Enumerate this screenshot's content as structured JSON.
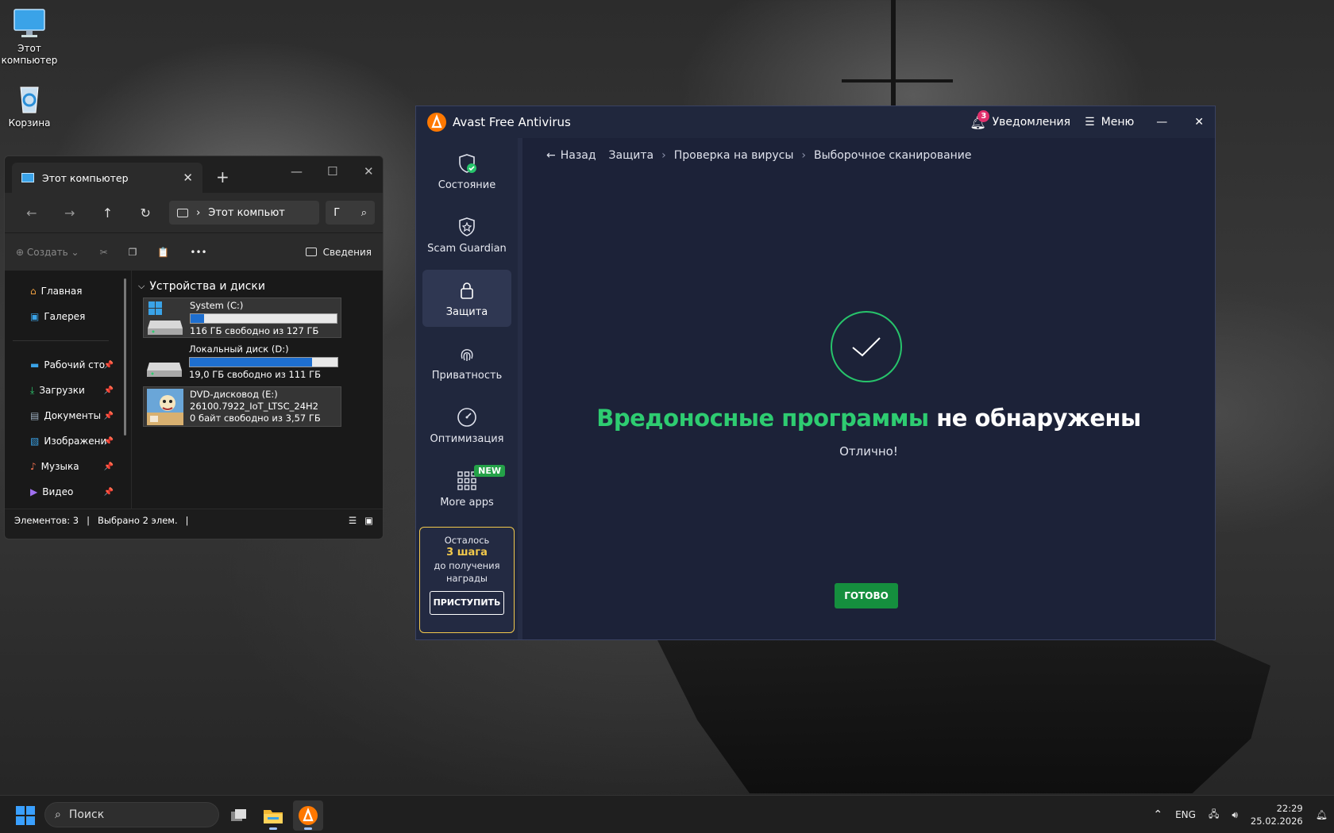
{
  "desktop": {
    "icons": [
      {
        "label": "Этот компьютер"
      },
      {
        "label": "Корзина"
      }
    ]
  },
  "explorer": {
    "tab_title": "Этот компьютер",
    "address": "Этот компьют",
    "search_text": "Г",
    "toolbar": {
      "create_label": "Создать",
      "details_label": "Сведения"
    },
    "sidebar": {
      "items": [
        {
          "label": "Главная",
          "pinned": false
        },
        {
          "label": "Галерея",
          "pinned": false
        },
        {
          "label": "Рабочий сто",
          "pinned": true
        },
        {
          "label": "Загрузки",
          "pinned": true
        },
        {
          "label": "Документы",
          "pinned": true
        },
        {
          "label": "Изображени",
          "pinned": true
        },
        {
          "label": "Музыка",
          "pinned": true
        },
        {
          "label": "Видео",
          "pinned": true
        }
      ]
    },
    "group_title": "Устройства и диски",
    "drives": [
      {
        "name": "System (C:)",
        "info": "116 ГБ свободно из 127 ГБ",
        "used_fraction": 0.09
      },
      {
        "name": "Локальный диск (D:)",
        "info": "19,0 ГБ свободно из 111 ГБ",
        "used_fraction": 0.83
      },
      {
        "name": "DVD-дисковод (E:)",
        "label2": "26100.7922_IoT_LTSC_24H2",
        "info": "0 байт свободно из 3,57 ГБ"
      }
    ],
    "status": {
      "items": "Элементов: 3",
      "selected": "Выбрано 2 элем."
    }
  },
  "avast": {
    "title": "Avast Free Antivirus",
    "notifications_label": "Уведомления",
    "notifications_count": "3",
    "menu_label": "Меню",
    "nav": [
      {
        "label": "Состояние",
        "icon": "shield-check-icon"
      },
      {
        "label": "Scam Guardian",
        "icon": "shield-star-icon"
      },
      {
        "label": "Защита",
        "icon": "lock-icon",
        "active": true
      },
      {
        "label": "Приватность",
        "icon": "fingerprint-icon"
      },
      {
        "label": "Оптимизация",
        "icon": "gauge-icon"
      },
      {
        "label": "More apps",
        "icon": "grid-icon",
        "badge": "NEW"
      }
    ],
    "reward": {
      "line1": "Осталось",
      "steps": "3 шага",
      "line2": "до получения",
      "line3": "награды",
      "button": "ПРИСТУПИТЬ"
    },
    "breadcrumb": {
      "back": "Назад",
      "items": [
        "Защита",
        "Проверка на вирусы",
        "Выборочное сканирование"
      ]
    },
    "result": {
      "highlight": "Вредоносные программы",
      "rest": "не обнаружены",
      "subtitle": "Отлично!"
    },
    "done_button": "ГОТОВО",
    "colors": {
      "accent_green": "#2ecc71",
      "button_green": "#158f3e",
      "brand_orange": "#ff7800",
      "reward_border": "#f2c94c"
    }
  },
  "taskbar": {
    "search_placeholder": "Поиск",
    "lang": "ENG",
    "time": "22:29",
    "date": "25.02.2026"
  }
}
